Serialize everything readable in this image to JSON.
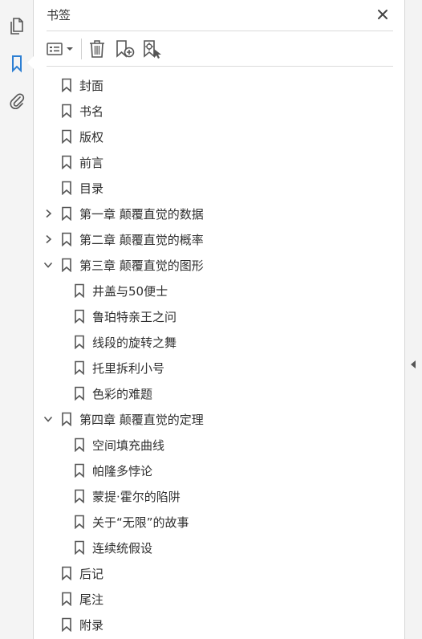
{
  "panel": {
    "title": "书签"
  },
  "rail": {
    "icons": [
      "pages-icon",
      "bookmark-icon",
      "attachment-icon"
    ],
    "active": "bookmark-icon",
    "accent": "#2d7fd3"
  },
  "toolbar": {
    "buttons": [
      "options-menu-icon",
      "delete-icon",
      "new-bookmark-icon",
      "bookmark-from-selection-icon"
    ]
  },
  "bookmarks": [
    {
      "label": "封面",
      "level": 0,
      "expander": "none"
    },
    {
      "label": "书名",
      "level": 0,
      "expander": "none"
    },
    {
      "label": "版权",
      "level": 0,
      "expander": "none"
    },
    {
      "label": "前言",
      "level": 0,
      "expander": "none"
    },
    {
      "label": "目录",
      "level": 0,
      "expander": "none"
    },
    {
      "label": "第一章  颠覆直觉的数据",
      "level": 0,
      "expander": "collapsed"
    },
    {
      "label": "第二章  颠覆直觉的概率",
      "level": 0,
      "expander": "collapsed"
    },
    {
      "label": "第三章  颠覆直觉的图形",
      "level": 0,
      "expander": "expanded"
    },
    {
      "label": "井盖与50便士",
      "level": 1,
      "expander": "none"
    },
    {
      "label": "鲁珀特亲王之问",
      "level": 1,
      "expander": "none"
    },
    {
      "label": "线段的旋转之舞",
      "level": 1,
      "expander": "none"
    },
    {
      "label": "托里拆利小号",
      "level": 1,
      "expander": "none"
    },
    {
      "label": "色彩的难题",
      "level": 1,
      "expander": "none"
    },
    {
      "label": "第四章  颠覆直觉的定理",
      "level": 0,
      "expander": "expanded"
    },
    {
      "label": "空间填充曲线",
      "level": 1,
      "expander": "none"
    },
    {
      "label": "帕隆多悖论",
      "level": 1,
      "expander": "none"
    },
    {
      "label": "蒙提·霍尔的陷阱",
      "level": 1,
      "expander": "none"
    },
    {
      "label": "关于“无限”的故事",
      "level": 1,
      "expander": "none"
    },
    {
      "label": "连续统假设",
      "level": 1,
      "expander": "none"
    },
    {
      "label": "后记",
      "level": 0,
      "expander": "none"
    },
    {
      "label": "尾注",
      "level": 0,
      "expander": "none"
    },
    {
      "label": "附录",
      "level": 0,
      "expander": "none"
    }
  ]
}
